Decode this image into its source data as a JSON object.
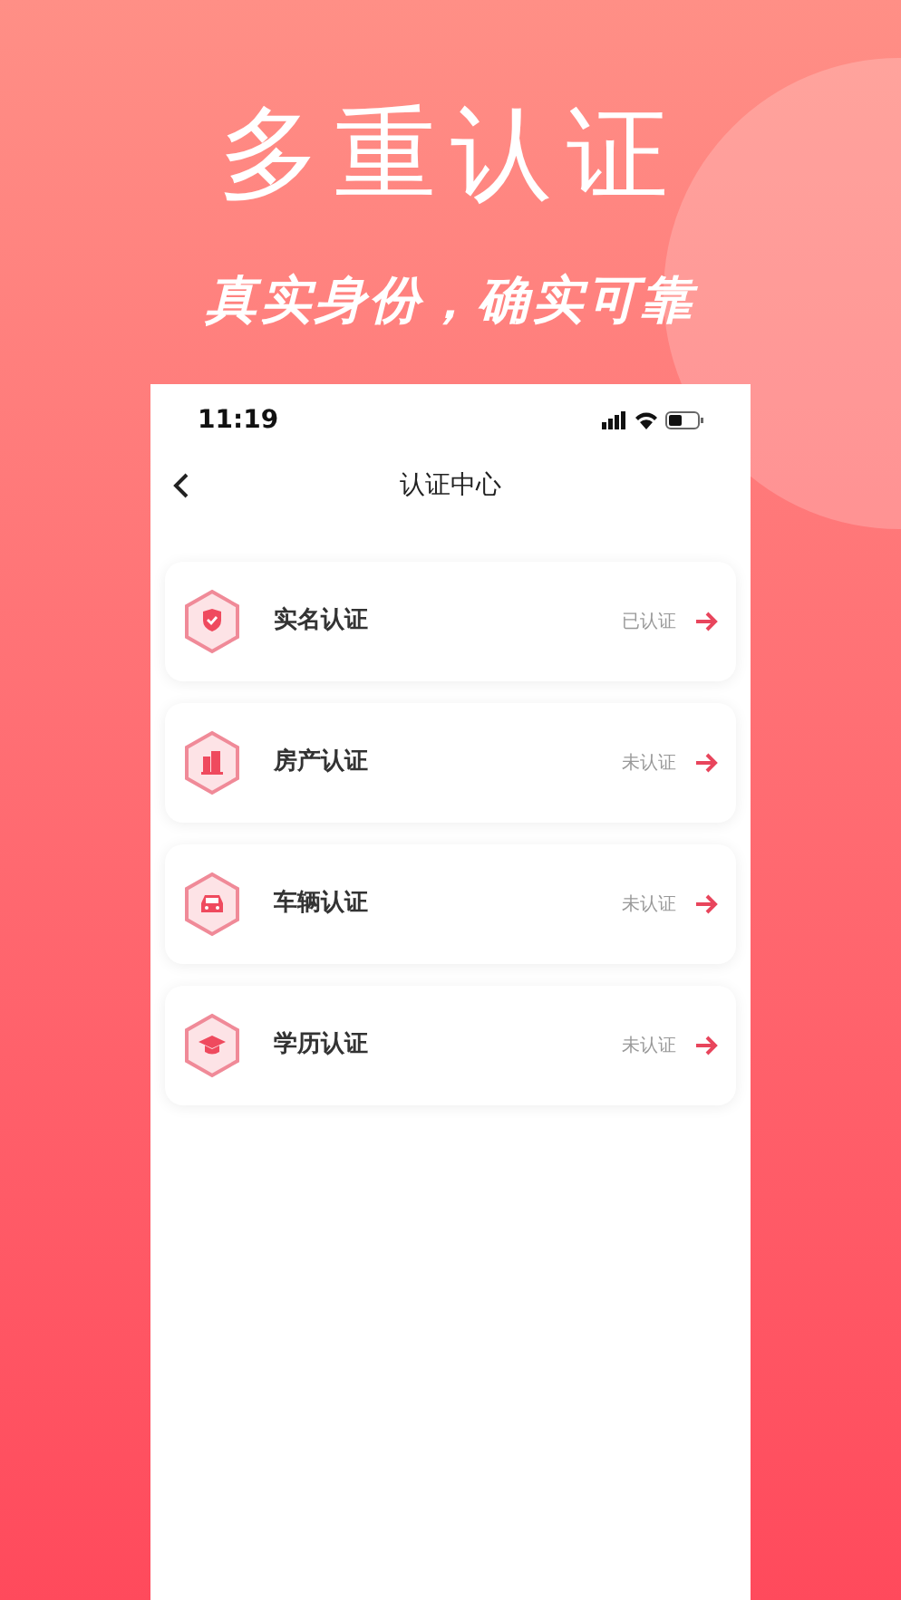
{
  "headline": "多重认证",
  "subtitle": "真实身份，确实可靠",
  "status_bar": {
    "time": "11:19"
  },
  "nav": {
    "title": "认证中心"
  },
  "items": [
    {
      "kind": "shield",
      "label": "实名认证",
      "status": "已认证"
    },
    {
      "kind": "building",
      "label": "房产认证",
      "status": "未认证"
    },
    {
      "kind": "car",
      "label": "车辆认证",
      "status": "未认证"
    },
    {
      "kind": "cap",
      "label": "学历认证",
      "status": "未认证"
    }
  ]
}
